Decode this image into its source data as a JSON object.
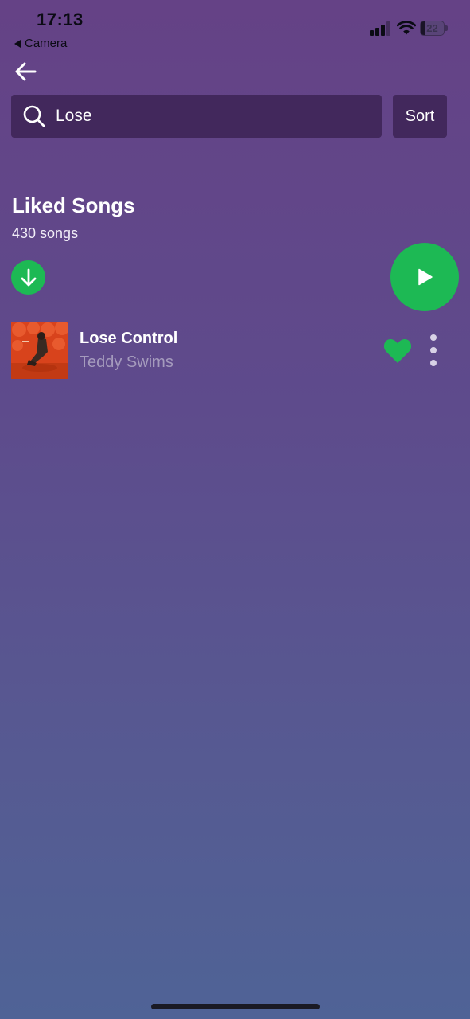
{
  "status_bar": {
    "time": "17:13",
    "back_app_label": "Camera",
    "battery_level": "22",
    "battery_fraction": 0.22,
    "icons": [
      "signal-icon",
      "wifi-icon",
      "battery-icon"
    ]
  },
  "nav": {
    "back_icon": "arrow-left-icon"
  },
  "search": {
    "value": "Lose",
    "icon": "search-icon"
  },
  "sort_label": "Sort",
  "playlist": {
    "title": "Liked Songs",
    "count": "430 songs",
    "download_icon": "arrow-down-icon",
    "play_icon": "play-icon"
  },
  "tracks": [
    {
      "title": "Lose Control",
      "artist": "Teddy Swims",
      "liked": true,
      "like_icon": "heart-icon",
      "more_icon": "more-vertical-icon"
    }
  ],
  "colors": {
    "accent": "#1db954",
    "search_bg": "#42285c",
    "background_top": "#654286",
    "background_bottom": "#4f6396",
    "artist_text": "#a59bbd"
  }
}
